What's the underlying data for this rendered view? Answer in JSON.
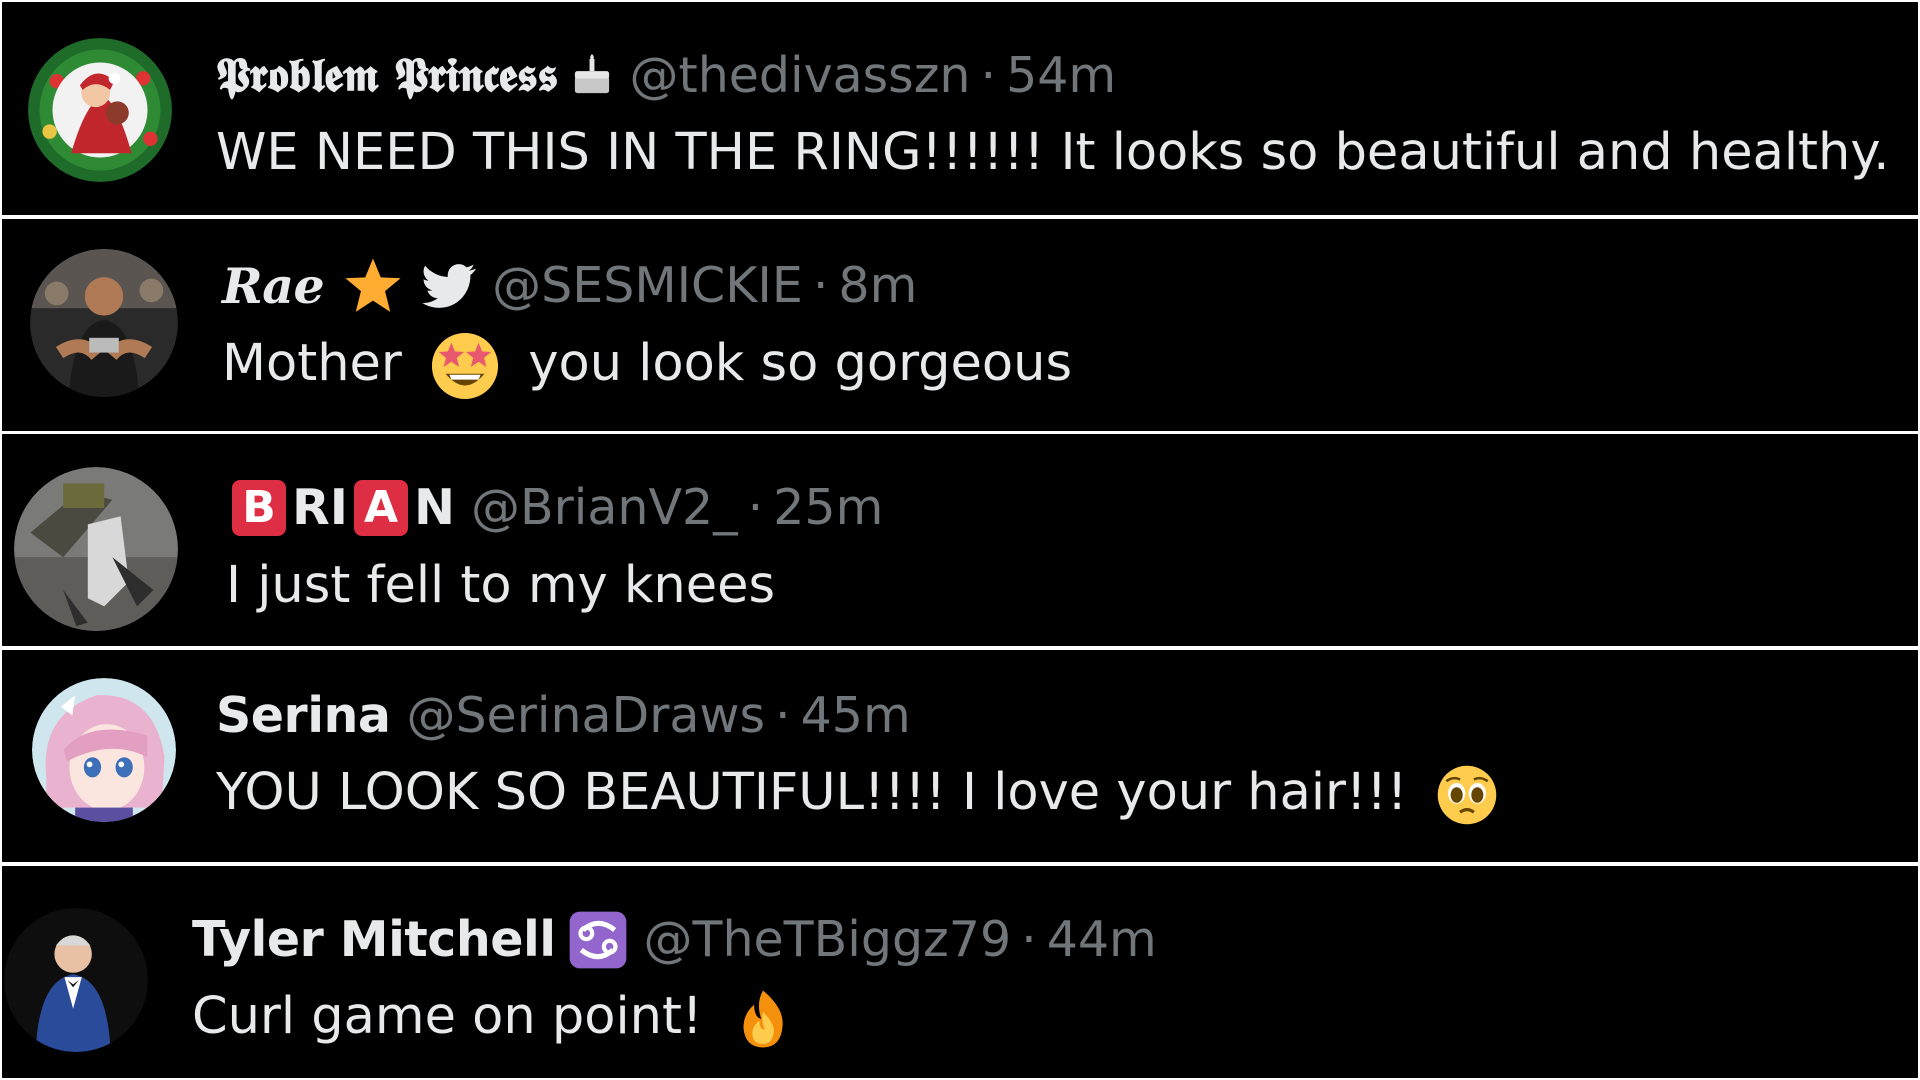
{
  "tweets": [
    {
      "display_name": "𝕻𝖗𝖔𝖇𝖑𝖊𝖒 𝕻𝖗𝖎𝖓𝖈𝖊𝖘𝖘",
      "name_emoji": "birthday-cake-icon",
      "handle": "@thedivasszn",
      "separator": "·",
      "time": "54m",
      "text": "WE NEED THIS IN THE RING!!!!!! It looks so beautiful and healthy."
    },
    {
      "display_name": "𝑹𝒂𝒆",
      "name_emoji": [
        "star-icon",
        "bird-icon"
      ],
      "handle": "@SESMICKIE",
      "separator": "·",
      "time": "8m",
      "text_before": "Mother",
      "text_emoji": "star-struck-icon",
      "text_after": "you look so gorgeous"
    },
    {
      "display_name_parts": [
        "B",
        "RI",
        "A",
        "N"
      ],
      "handle": "@BrianV2_",
      "separator": "·",
      "time": "25m",
      "text": "I just fell to my knees"
    },
    {
      "display_name": "Serina",
      "handle": "@SerinaDraws",
      "separator": "·",
      "time": "45m",
      "text": "YOU LOOK SO BEAUTIFUL!!!! I love your hair!!!",
      "text_emoji": "pleading-face-icon"
    },
    {
      "display_name": "Tyler Mitchell",
      "name_emoji": "cancer-zodiac-icon",
      "handle": "@TheTBiggz79",
      "separator": "·",
      "time": "44m",
      "text": "Curl game on point!",
      "text_emoji": "fire-icon"
    }
  ],
  "colors": {
    "background": "#000000",
    "text": "#e7e9ea",
    "secondary": "#71767b",
    "divider": "#ffffff"
  }
}
